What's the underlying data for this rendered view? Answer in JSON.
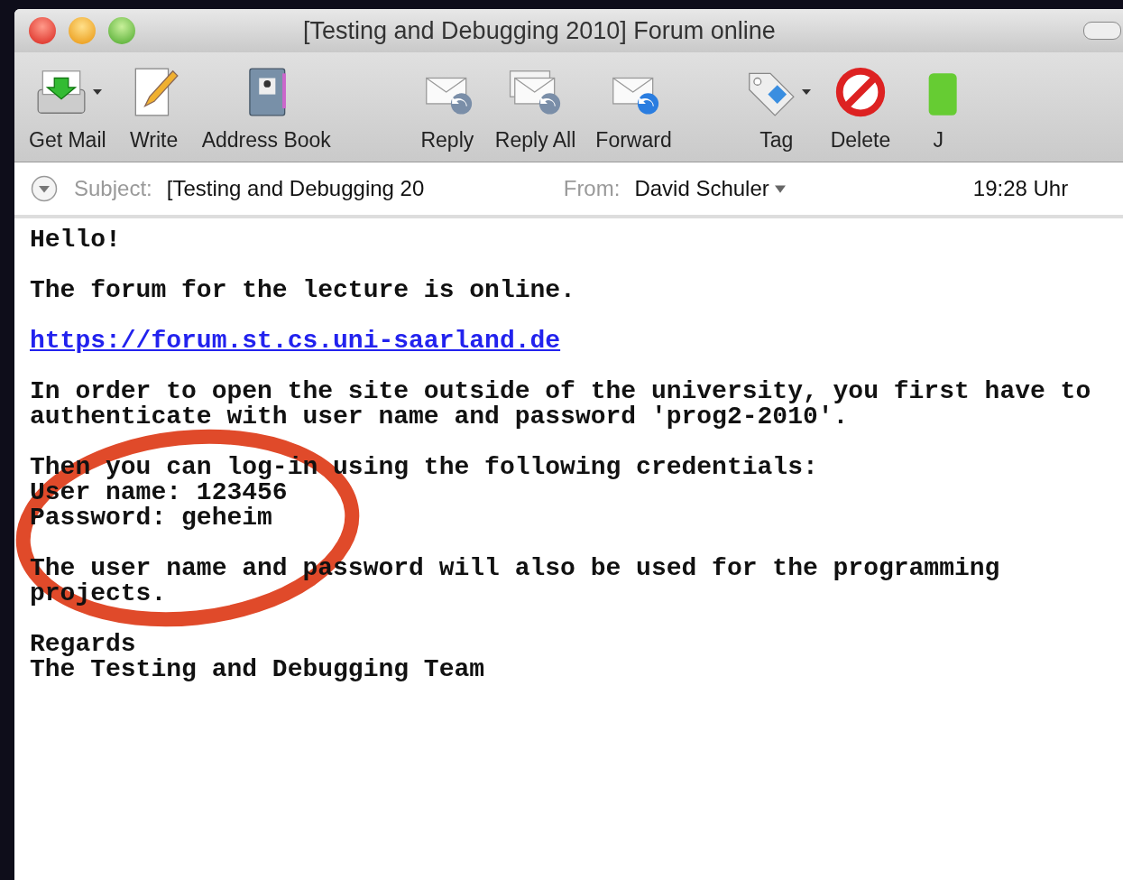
{
  "window": {
    "title": "[Testing and Debugging 2010] Forum online"
  },
  "toolbar": {
    "groups": [
      [
        {
          "label": "Get Mail",
          "kind": "getmail",
          "dropdown": true
        },
        {
          "label": "Write",
          "kind": "write",
          "dropdown": false
        },
        {
          "label": "Address Book",
          "kind": "addressbook",
          "dropdown": false
        }
      ],
      [
        {
          "label": "Reply",
          "kind": "reply",
          "dropdown": false
        },
        {
          "label": "Reply All",
          "kind": "replyall",
          "dropdown": false
        },
        {
          "label": "Forward",
          "kind": "forward",
          "dropdown": false
        }
      ],
      [
        {
          "label": "Tag",
          "kind": "tag",
          "dropdown": true
        },
        {
          "label": "Delete",
          "kind": "delete",
          "dropdown": false
        },
        {
          "label": "J",
          "kind": "junk",
          "dropdown": false
        }
      ]
    ]
  },
  "header": {
    "subject_label": "Subject:",
    "subject": "[Testing and Debugging 20",
    "from_label": "From:",
    "from": "David Schuler",
    "time": "19:28 Uhr"
  },
  "body": [
    {
      "kind": "text",
      "lines": [
        "Hello!"
      ]
    },
    {
      "kind": "text",
      "lines": [
        "The forum for the lecture is online."
      ]
    },
    {
      "kind": "link",
      "lines": [
        "https://forum.st.cs.uni-saarland.de"
      ]
    },
    {
      "kind": "text",
      "lines": [
        "In order to open the site outside of the university, you first have to",
        "authenticate with user name and password 'prog2-2010'."
      ]
    },
    {
      "kind": "text",
      "lines": [
        "Then you can log-in using the following credentials:",
        "User name: 123456",
        "Password: geheim"
      ]
    },
    {
      "kind": "text",
      "lines": [
        "The user name and password will also be used for the programming",
        "projects."
      ]
    },
    {
      "kind": "text",
      "lines": [
        "Regards",
        "The Testing and Debugging Team"
      ]
    }
  ]
}
